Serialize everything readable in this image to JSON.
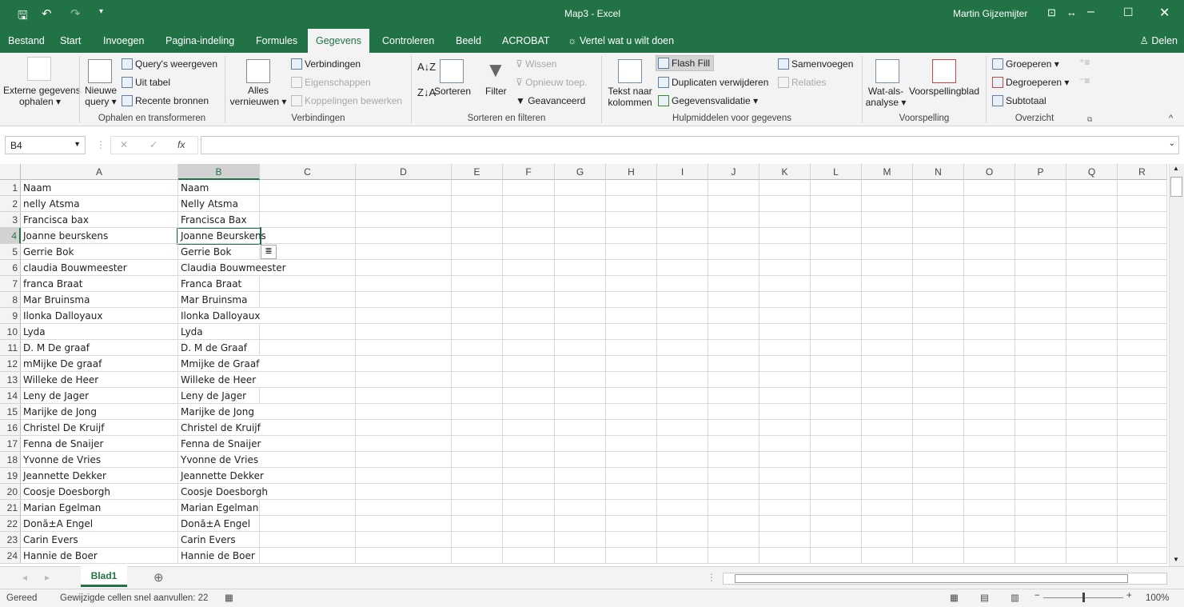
{
  "title": {
    "doc": "Map3 - Excel",
    "user": "Martin Gijzemijter"
  },
  "tabs": [
    "Bestand",
    "Start",
    "Invoegen",
    "Pagina-indeling",
    "Formules",
    "Gegevens",
    "Controleren",
    "Beeld",
    "ACROBAT"
  ],
  "tell_me": "Vertel wat u wilt doen",
  "share": "Delen",
  "ribbon": {
    "ext": "Externe gegevens",
    "ext2": "ophalen",
    "newq": "Nieuwe",
    "newq2": "query",
    "showq": "Query's weergeven",
    "fromtable": "Uit tabel",
    "recent": "Recente bronnen",
    "g1": "Ophalen en transformeren",
    "refresh": "Alles",
    "refresh2": "vernieuwen",
    "conn": "Verbindingen",
    "props": "Eigenschappen",
    "links": "Koppelingen bewerken",
    "g2": "Verbindingen",
    "sort": "Sorteren",
    "filter": "Filter",
    "clear": "Wissen",
    "reapply": "Opnieuw toep.",
    "advanced": "Geavanceerd",
    "g3": "Sorteren en filteren",
    "t2c": "Tekst naar",
    "t2c2": "kolommen",
    "flash": "Flash Fill",
    "dup": "Duplicaten verwijderen",
    "valid": "Gegevensvalidatie",
    "merge": "Samenvoegen",
    "rel": "Relaties",
    "g4": "Hulpmiddelen voor gegevens",
    "whatif": "Wat-als-",
    "whatif2": "analyse",
    "forecast": "Voorspellingblad",
    "g5": "Voorspelling",
    "group": "Groeperen",
    "ungroup": "Degroeperen",
    "subtotal": "Subtotaal",
    "g6": "Overzicht"
  },
  "namebox": "B4",
  "fx": "fx",
  "formula": "",
  "columns": [
    "A",
    "B",
    "C",
    "D",
    "E",
    "F",
    "G",
    "H",
    "I",
    "J",
    "K",
    "L",
    "M",
    "N",
    "O",
    "P",
    "Q",
    "R"
  ],
  "rows": [
    [
      "Naam",
      "Naam"
    ],
    [
      "nelly Atsma",
      "Nelly Atsma"
    ],
    [
      "Francisca bax",
      "Francisca Bax"
    ],
    [
      "Joanne beurskens",
      "Joanne Beurskens"
    ],
    [
      "Gerrie Bok",
      "Gerrie Bok"
    ],
    [
      "claudia Bouwmeester",
      "Claudia Bouwmeester"
    ],
    [
      "franca Braat",
      "Franca Braat"
    ],
    [
      "Mar Bruinsma",
      "Mar Bruinsma"
    ],
    [
      "Ilonka Dalloyaux",
      "Ilonka Dalloyaux"
    ],
    [
      "Lyda",
      "Lyda"
    ],
    [
      "D. M De graaf",
      "D. M de Graaf"
    ],
    [
      "mMijke De graaf",
      "Mmijke de Graaf"
    ],
    [
      "Willeke de Heer",
      "Willeke de Heer"
    ],
    [
      "Leny de Jager",
      "Leny de Jager"
    ],
    [
      "Marijke de Jong",
      "Marijke de Jong"
    ],
    [
      "Christel De Kruijf",
      "Christel de Kruijf"
    ],
    [
      "Fenna de Snaijer",
      "Fenna de Snaijer"
    ],
    [
      "Yvonne de Vries",
      "Yvonne de Vries"
    ],
    [
      "Jeannette Dekker",
      "Jeannette Dekker"
    ],
    [
      "Coosje Doesborgh",
      "Coosje Doesborgh"
    ],
    [
      "Marian Egelman",
      "Marian Egelman"
    ],
    [
      "Donã±A Engel",
      "Donã±A Engel"
    ],
    [
      "Carin Evers",
      "Carin Evers"
    ],
    [
      "Hannie de Boer",
      "Hannie de Boer"
    ]
  ],
  "sheet": "Blad1",
  "status": {
    "ready": "Gereed",
    "flash": "Gewijzigde cellen snel aanvullen: 22",
    "zoom": "100%"
  }
}
